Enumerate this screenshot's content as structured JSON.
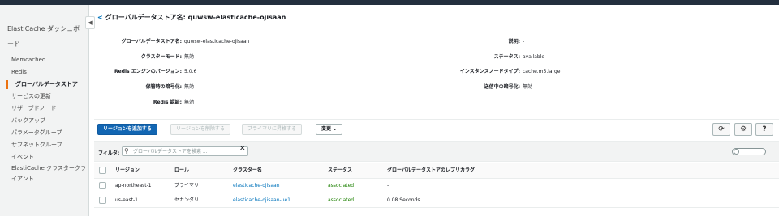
{
  "sidebar": {
    "title": "ElastiCache ダッシュボード",
    "collapse_icon": "◀",
    "items": [
      {
        "label": "Memcached"
      },
      {
        "label": "Redis"
      },
      {
        "label": "グローバルデータストア"
      },
      {
        "label": "サービスの更新"
      },
      {
        "label": "リザーブドノード"
      },
      {
        "label": "バックアップ"
      },
      {
        "label": "パラメータグループ"
      },
      {
        "label": "サブネットグループ"
      },
      {
        "label": "イベント"
      },
      {
        "label": "ElastiCache クラスタークライアント"
      }
    ]
  },
  "header": {
    "back": "<",
    "title": "グローバルデータストア名: quwsw-elasticache-ojisaan"
  },
  "details": {
    "left": [
      {
        "label": "グローバルデータストア名:",
        "value": "quwsw-elasticache-ojisaan"
      },
      {
        "label": "クラスターモード:",
        "value": "無効"
      },
      {
        "label": "Redis エンジンのバージョン:",
        "value": "5.0.6"
      },
      {
        "label": "保管時の暗号化:",
        "value": "無効"
      },
      {
        "label": "Redis 認証:",
        "value": "無効"
      }
    ],
    "right": [
      {
        "label": "説明:",
        "value": "-"
      },
      {
        "label": "ステータス:",
        "value": "available"
      },
      {
        "label": "インスタンスノードタイプ:",
        "value": "cache.m5.large"
      },
      {
        "label": "送信中の暗号化:",
        "value": "無効"
      }
    ]
  },
  "toolbar": {
    "add_region": "リージョンを追加する",
    "remove_region": "リージョンを削除する",
    "promote": "プライマリに昇格する",
    "modify": "変更 ⌄",
    "refresh_icon": "⟳",
    "settings_icon": "⚙",
    "help_icon": "?"
  },
  "filter": {
    "label": "フィルタ:",
    "placeholder": "グローバルデータストアを検索 ...",
    "value": "",
    "search_icon": "⚲",
    "clear_icon": "✕"
  },
  "table": {
    "headers": [
      "リージョン",
      "ロール",
      "クラスター名",
      "ステータス",
      "グローバルデータストアのレプリカラグ"
    ],
    "rows": [
      [
        "ap-northeast-1",
        "プライマリ",
        "elasticache-ojisaan",
        "associated",
        "-"
      ],
      [
        "us-east-1",
        "セカンダリ",
        "elasticache-ojisaan-ue1",
        "associated",
        "0.08 Seconds"
      ]
    ]
  },
  "colors": {
    "accent": "#ec7211",
    "primary_button": "#1266b3",
    "link": "#0073bb",
    "status_ok": "#1d8102"
  }
}
